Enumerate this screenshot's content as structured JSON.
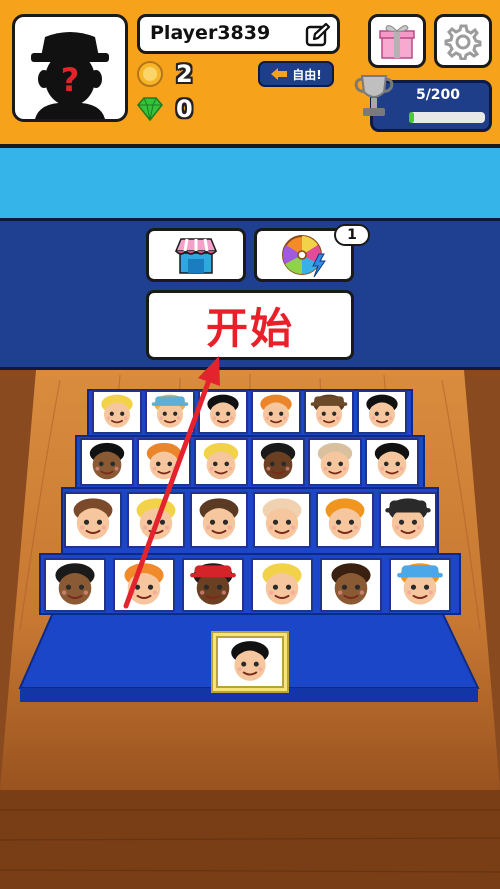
{
  "player": {
    "name": "Player3839"
  },
  "currency": {
    "coins": "2",
    "gems": "0"
  },
  "free_button": {
    "label": "自由!"
  },
  "progress": {
    "text": "5/200",
    "fraction": 0.025
  },
  "start_button": {
    "label": "开始"
  },
  "spin_badge": {
    "count": "1"
  },
  "colors": {
    "header": "#f7a21b",
    "sky": "#34b4e8",
    "panel": "#1f3f90",
    "start_text": "#e8202a",
    "board": "#1c46c8"
  },
  "icons": [
    "question-avatar-icon",
    "edit-icon",
    "coin-icon",
    "gem-icon",
    "back-arrow-icon",
    "gift-icon",
    "gear-icon",
    "trophy-icon",
    "shop-icon",
    "prize-wheel-icon",
    "red-arrow"
  ],
  "characters": {
    "row1": [
      {
        "skin": "#f6c79e",
        "hair": "#f2d248",
        "hat": ""
      },
      {
        "skin": "#f6c79e",
        "hair": "#e6b24a",
        "hat": "#5ab0d8"
      },
      {
        "skin": "#f6c79e",
        "hair": "#111111",
        "hat": ""
      },
      {
        "skin": "#f6c79e",
        "hair": "#e9852a",
        "hat": ""
      },
      {
        "skin": "#f6c79e",
        "hair": "#5a3a22",
        "hat": "#6b4a2a"
      },
      {
        "skin": "#f6c79e",
        "hair": "#111111",
        "hat": ""
      }
    ],
    "row2": [
      {
        "skin": "#8a5a34",
        "hair": "#111111",
        "hat": ""
      },
      {
        "skin": "#f6c79e",
        "hair": "#e9852a",
        "hat": ""
      },
      {
        "skin": "#f6c79e",
        "hair": "#f2d248",
        "hat": ""
      },
      {
        "skin": "#6b3f22",
        "hair": "#1a1a1a",
        "hat": ""
      },
      {
        "skin": "#f6c79e",
        "hair": "#d9c1a0",
        "hat": ""
      },
      {
        "skin": "#f6c79e",
        "hair": "#111111",
        "hat": ""
      }
    ],
    "row3": [
      {
        "skin": "#f6c79e",
        "hair": "#7a4a2a",
        "hat": ""
      },
      {
        "skin": "#f6c79e",
        "hair": "#f2d248",
        "hat": ""
      },
      {
        "skin": "#f6c79e",
        "hair": "#5a3a22",
        "hat": ""
      },
      {
        "skin": "#f6c79e",
        "hair": "#f0d2b0",
        "hat": ""
      },
      {
        "skin": "#f6c79e",
        "hair": "#f0951f",
        "hat": ""
      },
      {
        "skin": "#f6c79e",
        "hair": "#2a2a2a",
        "hat": "#2a2a2a"
      }
    ],
    "row4": [
      {
        "skin": "#8a5a34",
        "hair": "#1a1a1a",
        "hat": ""
      },
      {
        "skin": "#f6c79e",
        "hair": "#f08a2a",
        "hat": ""
      },
      {
        "skin": "#6b3f22",
        "hair": "#1a1a1a",
        "hat": "#d4242a"
      },
      {
        "skin": "#f6c79e",
        "hair": "#f2d248",
        "hat": ""
      },
      {
        "skin": "#8a5a34",
        "hair": "#3a2010",
        "hat": ""
      },
      {
        "skin": "#f6c79e",
        "hair": "#f0951f",
        "hat": "#4aa8e8"
      }
    ],
    "selected": {
      "skin": "#f6c79e",
      "hair": "#111111",
      "hat": ""
    }
  }
}
